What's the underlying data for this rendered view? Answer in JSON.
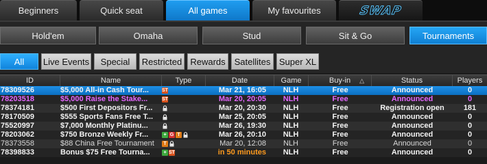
{
  "top_tabs": [
    {
      "label": "Beginners"
    },
    {
      "label": "Quick seat"
    },
    {
      "label": "All games"
    },
    {
      "label": "My favourites"
    }
  ],
  "swap_logo_text": "SWAP",
  "game_tabs": [
    {
      "label": "Hold'em"
    },
    {
      "label": "Omaha"
    },
    {
      "label": "Stud"
    },
    {
      "label": "Sit & Go"
    },
    {
      "label": "Tournaments"
    }
  ],
  "filters": [
    {
      "label": "All"
    },
    {
      "label": "Live Events"
    },
    {
      "label": "Special"
    },
    {
      "label": "Restricted"
    },
    {
      "label": "Rewards"
    },
    {
      "label": "Satellites"
    },
    {
      "label": "Super XL"
    }
  ],
  "columns": {
    "id": "ID",
    "name": "Name",
    "type": "Type",
    "date": "Date",
    "game": "Game",
    "buyin": "Buy-in",
    "status": "Status",
    "players": "Players"
  },
  "sort_icon": "triangle-up-icon",
  "colors": {
    "accent_blue": "#1a8fe6",
    "highlight_magenta": "#e566ff",
    "highlight_orange": "#ff9a1e"
  },
  "rows": [
    {
      "id": "78309526",
      "name": "$5,000 All-in Cash Tour...",
      "type_icons": [
        "st"
      ],
      "date": "Mar 21, 16:05",
      "game": "NLH",
      "buyin": "Free",
      "status": "Announced",
      "players": "0"
    },
    {
      "id": "78203518",
      "name": "$5,000 Raise the Stake...",
      "type_icons": [
        "st"
      ],
      "date": "Mar 20, 20:05",
      "game": "NLH",
      "buyin": "Free",
      "status": "Announced",
      "players": "0"
    },
    {
      "id": "78374181",
      "name": "$500 First Depositors Fr...",
      "type_icons": [
        "lock"
      ],
      "date": "Mar 20, 20:30",
      "game": "NLH",
      "buyin": "Free",
      "status": "Registration open",
      "players": "181"
    },
    {
      "id": "78170509",
      "name": "$555 Sports Fans Free T...",
      "type_icons": [
        "lock"
      ],
      "date": "Mar 25, 20:05",
      "game": "NLH",
      "buyin": "Free",
      "status": "Announced",
      "players": "0"
    },
    {
      "id": "75520997",
      "name": "$7,000 Monthly Platinu...",
      "type_icons": [
        "lock"
      ],
      "date": "Mar 26, 19:30",
      "game": "NLH",
      "buyin": "Free",
      "status": "Announced",
      "players": "0"
    },
    {
      "id": "78203062",
      "name": "$750 Bronze Weekly Fr...",
      "type_icons": [
        "plus",
        "g",
        "t",
        "lock"
      ],
      "date": "Mar 26, 20:10",
      "game": "NLH",
      "buyin": "Free",
      "status": "Announced",
      "players": "0"
    },
    {
      "id": "78373558",
      "name": "$88 China Free Tournament",
      "type_icons": [
        "t",
        "lock"
      ],
      "date": "Mar 20, 12:08",
      "game": "NLH",
      "buyin": "Free",
      "status": "Announced",
      "players": "0"
    },
    {
      "id": "78398833",
      "name": "Bonus $75 Free Tourna...",
      "type_icons": [
        "plus",
        "st"
      ],
      "date": "in 50 minutes",
      "game": "NLH",
      "buyin": "Free",
      "status": "Announced",
      "players": "0"
    }
  ]
}
